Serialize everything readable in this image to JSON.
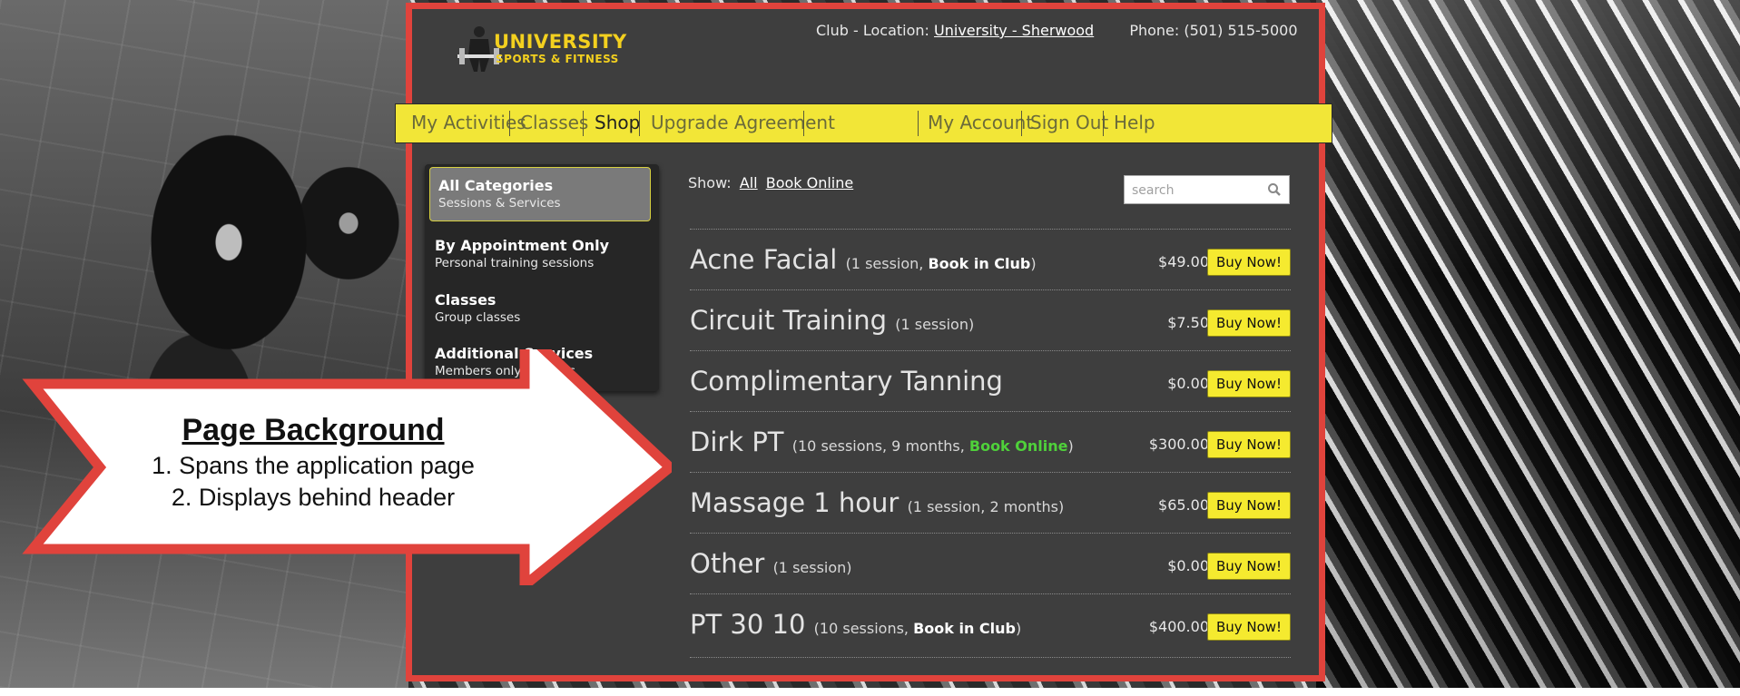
{
  "logo": {
    "line1": "UNIVERSITY",
    "line2": "SPORTS & FITNESS",
    "icon": "weightlifter-icon"
  },
  "header": {
    "club_label": "Club - Location:",
    "club_location": "University - Sherwood",
    "phone": "Phone: (501) 515-5000"
  },
  "nav": {
    "left": [
      "My Activities",
      "Classes",
      "Shop",
      "Upgrade Agreement"
    ],
    "right": [
      "My Account",
      "Sign Out",
      "Help"
    ],
    "active": "Shop"
  },
  "sidebar": {
    "categories": [
      {
        "title": "All Categories",
        "subtitle": "Sessions & Services"
      },
      {
        "title": "By Appointment Only",
        "subtitle": "Personal training sessions"
      },
      {
        "title": "Classes",
        "subtitle": "Group classes"
      },
      {
        "title": "Additional Services",
        "subtitle": "Members only services"
      }
    ]
  },
  "filter": {
    "label": "Show:",
    "all": "All",
    "book_online": "Book Online"
  },
  "search": {
    "placeholder": "search",
    "icon": "search-icon"
  },
  "items": [
    {
      "name": "Acne Facial",
      "detail_prefix": "(1 session, ",
      "detail_bold": "Book in Club",
      "detail_suffix": ")",
      "price": "$49.00"
    },
    {
      "name": "Circuit Training",
      "detail_prefix": "(1 session)",
      "detail_bold": "",
      "detail_suffix": "",
      "price": "$7.50"
    },
    {
      "name": "Complimentary Tanning",
      "detail_prefix": "",
      "detail_bold": "",
      "detail_suffix": "",
      "price": "$0.00"
    },
    {
      "name": "Dirk PT",
      "detail_prefix": "(10 sessions, 9 months, ",
      "detail_online": "Book Online",
      "detail_suffix": ")",
      "price": "$300.00"
    },
    {
      "name": "Massage 1 hour",
      "detail_prefix": "(1 session, 2 months)",
      "detail_bold": "",
      "detail_suffix": "",
      "price": "$65.00"
    },
    {
      "name": "Other",
      "detail_prefix": "(1 session)",
      "detail_bold": "",
      "detail_suffix": "",
      "price": "$0.00"
    },
    {
      "name": "PT 30 10",
      "detail_prefix": "(10 sessions, ",
      "detail_bold": "Book in Club",
      "detail_suffix": ")",
      "price": "$400.00"
    }
  ],
  "buy_label": "Buy Now!",
  "callout": {
    "heading": "Page Background",
    "line1": "1. Spans the application page",
    "line2": "2. Displays behind header"
  },
  "colors": {
    "accent_yellow": "#f2e637",
    "border_red": "#e0433c",
    "panel_dark": "#3e3e3e",
    "online_green": "#4fd13a"
  }
}
